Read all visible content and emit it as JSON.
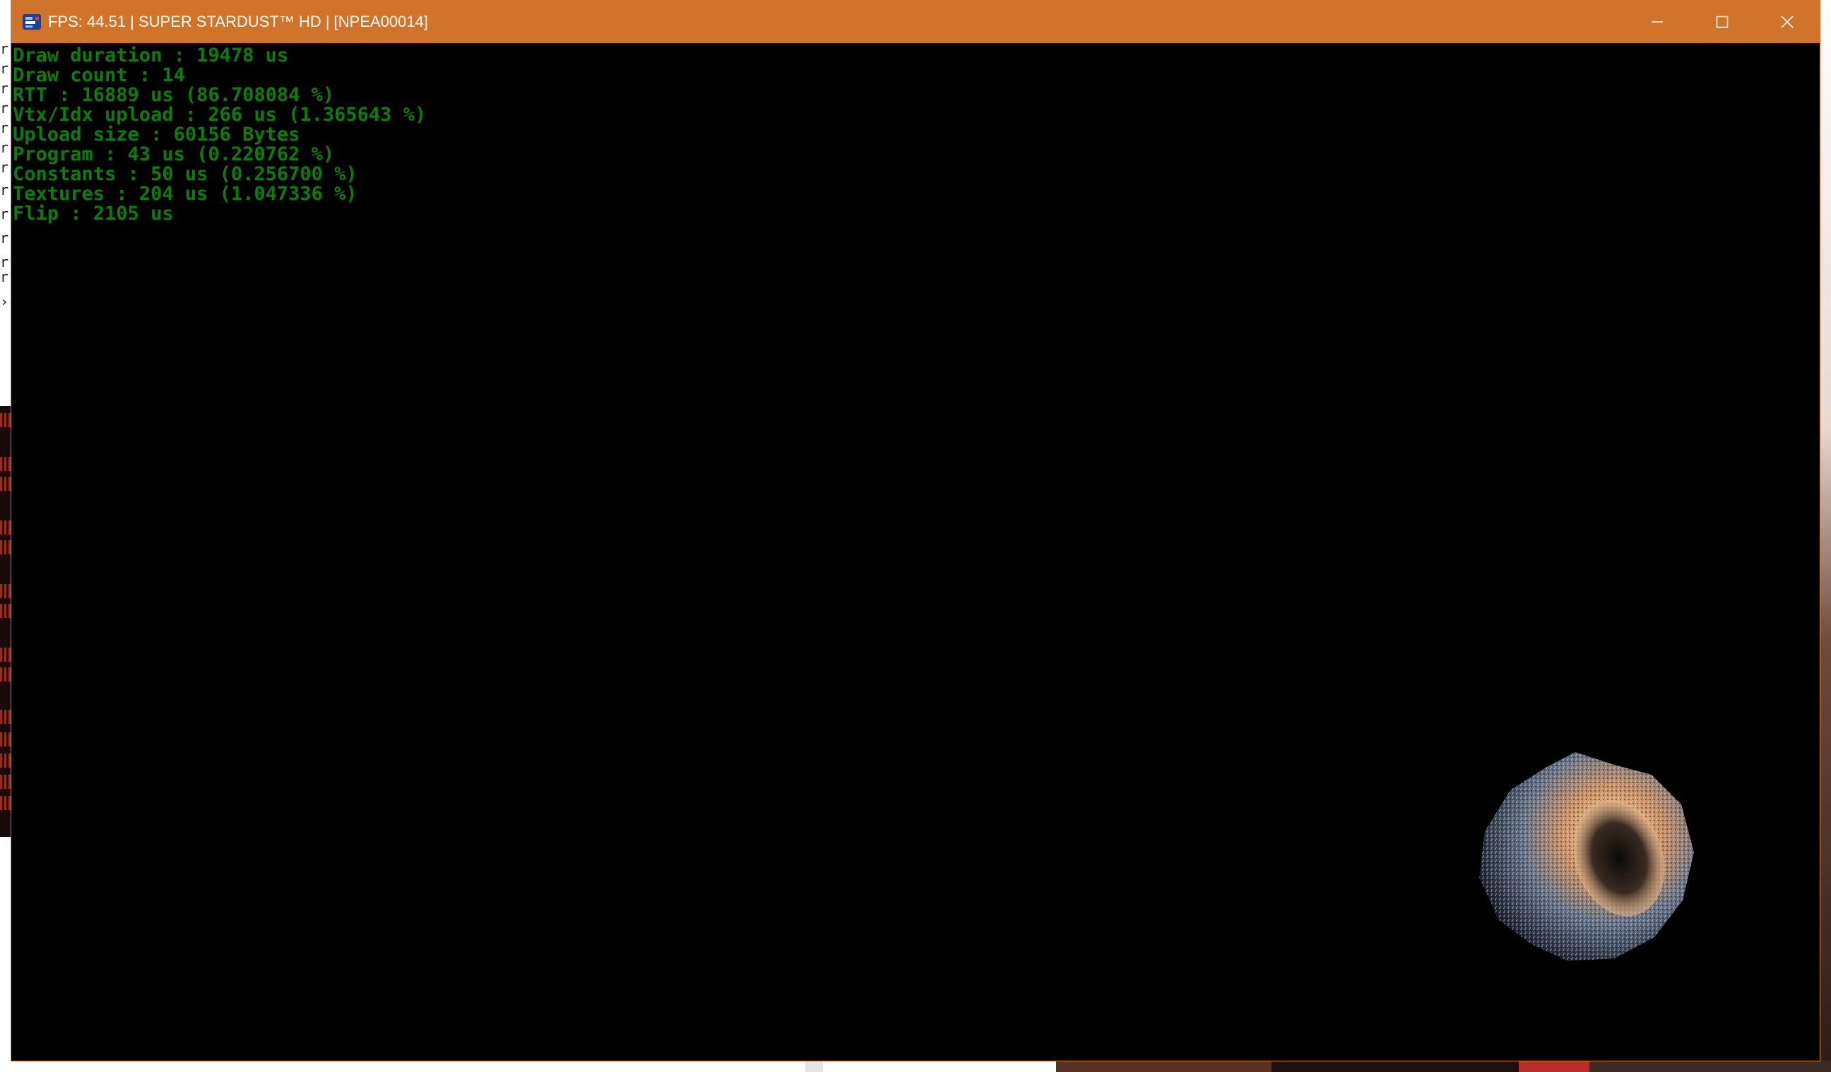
{
  "window": {
    "title": "FPS: 44.51 | SUPER STARDUST™ HD | [NPEA00014]",
    "titlebar_color": "#d0742c",
    "app_icon": "rpcs3-app-icon",
    "controls": {
      "minimize_icon": "minimize-icon",
      "maximize_icon": "maximize-icon",
      "close_icon": "close-icon"
    }
  },
  "overlay": {
    "color": "#0b7d0b",
    "lines": [
      "Draw duration : 19478 us",
      "Draw count : 14",
      "RTT : 16889 us (86.708084 %)",
      "Vtx/Idx upload : 266 us (1.365643 %)",
      "Upload size : 60156 Bytes",
      "Program : 43 us (0.220762 %)",
      "Constants : 50 us (0.256700 %)",
      "Textures : 204 us (1.047336 %)",
      "Flip : 2105 us"
    ]
  },
  "scene": {
    "background_color": "#000000",
    "object_icon": "asteroid-sprite"
  }
}
